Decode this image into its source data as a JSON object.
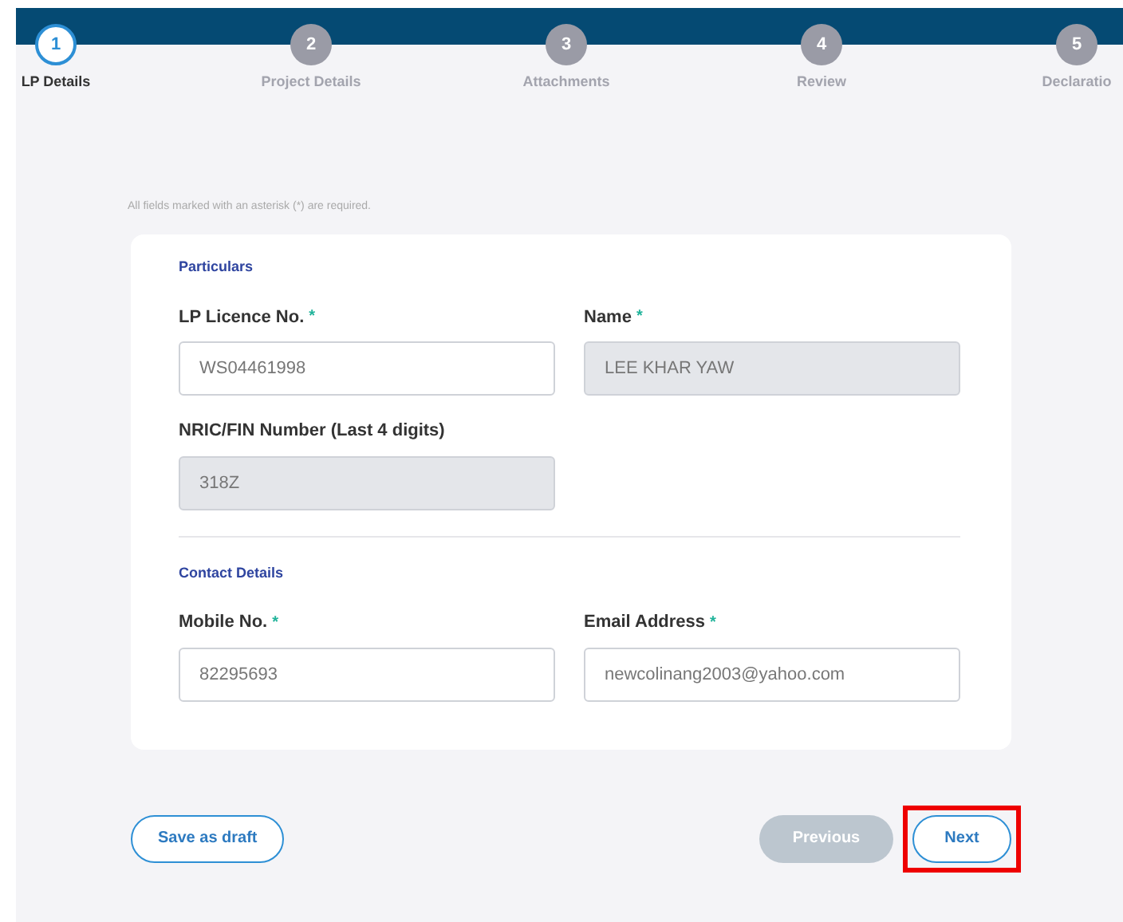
{
  "steps": [
    {
      "number": "1",
      "label": "LP Details",
      "selected": true
    },
    {
      "number": "2",
      "label": "Project Details",
      "selected": false
    },
    {
      "number": "3",
      "label": "Attachments",
      "selected": false
    },
    {
      "number": "4",
      "label": "Review",
      "selected": false
    },
    {
      "number": "5",
      "label": "Declaratio",
      "selected": false
    }
  ],
  "required_note": "All fields marked with an asterisk (*) are required.",
  "sections": [
    {
      "title": "Particulars",
      "fields": [
        {
          "label": "LP Licence No.",
          "required": true,
          "value": "WS04461998",
          "disabled": false
        },
        {
          "label": "Name",
          "required": true,
          "value": "LEE KHAR YAW",
          "disabled": true
        },
        {
          "label": "NRIC/FIN Number (Last 4 digits)",
          "required": false,
          "value": "318Z",
          "disabled": true
        }
      ]
    },
    {
      "title": "Contact Details",
      "fields": [
        {
          "label": "Mobile No.",
          "required": true,
          "value": "82295693",
          "disabled": false
        },
        {
          "label": "Email Address",
          "required": true,
          "value": "newcolinang2003@yahoo.com",
          "disabled": false
        }
      ]
    }
  ],
  "asterisk": "*",
  "save_button": "Save as draft",
  "previous_button": {
    "label": "Previous",
    "disabled": true
  },
  "next_button": {
    "label": "Next",
    "disabled": false,
    "highlighted": true
  }
}
